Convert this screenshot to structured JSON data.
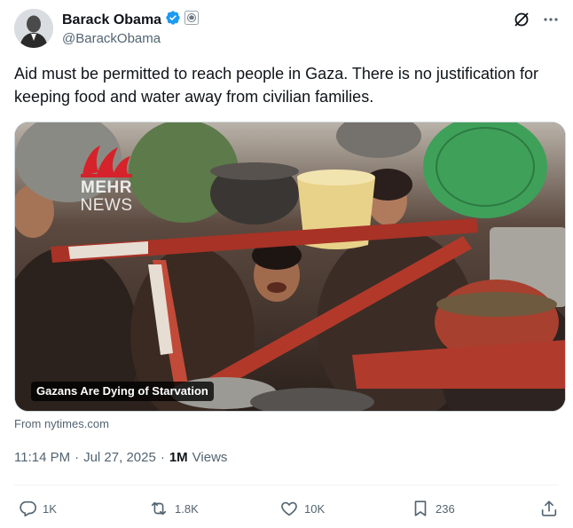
{
  "author": {
    "display_name": "Barack Obama",
    "handle": "@BarackObama",
    "verified": true,
    "verified_color": "#1d9bf0"
  },
  "tweet": {
    "text": "Aid must be permitted to reach people in Gaza. There is no justification for keeping food and water away from civilian families."
  },
  "media": {
    "caption": "Gazans Are Dying of Starvation",
    "watermark_line1": "MEHR",
    "watermark_line2": "NEWS",
    "watermark_color": "#d6222a"
  },
  "source": "From nytimes.com",
  "meta": {
    "time": "11:14 PM",
    "separator": "·",
    "date": "Jul 27, 2025",
    "views_count": "1M",
    "views_label": "Views"
  },
  "actions": {
    "replies": "1K",
    "reposts": "1.8K",
    "likes": "10K",
    "bookmarks": "236"
  },
  "icons": {
    "grok": "grok-icon",
    "more": "more-icon",
    "government_badge": "government-seal-icon",
    "reply": "reply-icon",
    "repost": "repost-icon",
    "like": "like-icon",
    "bookmark": "bookmark-icon",
    "share": "share-icon"
  }
}
